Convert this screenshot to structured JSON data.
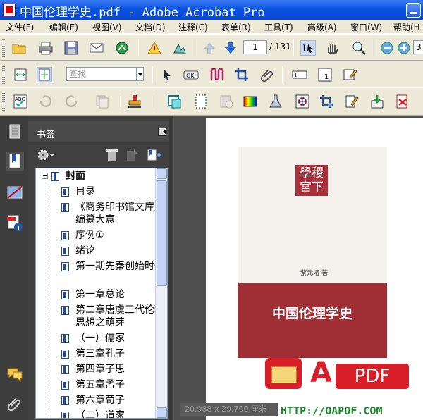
{
  "window": {
    "title": "中国伦理学史.pdf - Adobe Acrobat Pro"
  },
  "menu": {
    "items": [
      "文件(F)",
      "编辑(E)",
      "视图(V)",
      "文档(D)",
      "注释(C)",
      "表单(R)",
      "工具(T)",
      "高级(A)",
      "窗口(W)",
      "帮助(H"
    ]
  },
  "toolbar": {
    "page_current": "1",
    "page_total": "/ 131",
    "zoom_value": "3",
    "find_placeholder": "查找"
  },
  "bookmarks": {
    "panel_title": "书签",
    "items": [
      {
        "label": "封面",
        "lines": [
          "封面"
        ]
      },
      {
        "label": "目录",
        "lines": [
          "目录"
        ]
      },
      {
        "label": "《商务印书馆文库》编纂大意",
        "lines": [
          "《商务印书馆文",
          "库》编纂大意"
        ]
      },
      {
        "label": "序例①",
        "lines": [
          "序例①"
        ]
      },
      {
        "label": "绪论",
        "lines": [
          "绪论"
        ]
      },
      {
        "label": "第一期先秦创始时代",
        "lines": [
          "第一期先秦创始",
          "时代"
        ]
      },
      {
        "label": "第一章总论",
        "lines": [
          "第一章总论"
        ]
      },
      {
        "label": "第二章唐虞三代伦理思想之萌芽",
        "lines": [
          "第二章唐虞三代",
          "伦理思想之萌芽"
        ]
      },
      {
        "label": "（一）儒家",
        "lines": [
          "（一）儒家"
        ]
      },
      {
        "label": "第三章孔子",
        "lines": [
          "第三章孔子"
        ]
      },
      {
        "label": "第四章子思",
        "lines": [
          "第四章子思"
        ]
      },
      {
        "label": "第五章孟子",
        "lines": [
          "第五章孟子"
        ]
      },
      {
        "label": "第六章荀子",
        "lines": [
          "第六章荀子"
        ]
      },
      {
        "label": "（二）道家",
        "lines": [
          "（二）道家"
        ]
      }
    ]
  },
  "document": {
    "cover_seal_line1": "學稷",
    "cover_seal_line2": "宮下",
    "cover_author": "蔡元培 著",
    "cover_title": "中国伦理学史",
    "watermark_letter": "A",
    "watermark_pdf": "PDF",
    "watermark_url": "HTTP://OAPDF.COM",
    "page_size": "20.988 x 29.700 厘米"
  },
  "colors": {
    "title_bar": "#0a54e0",
    "cover_red": "#a02e35",
    "watermark_red": "#d81e26",
    "url_green": "#1a8a2a"
  }
}
